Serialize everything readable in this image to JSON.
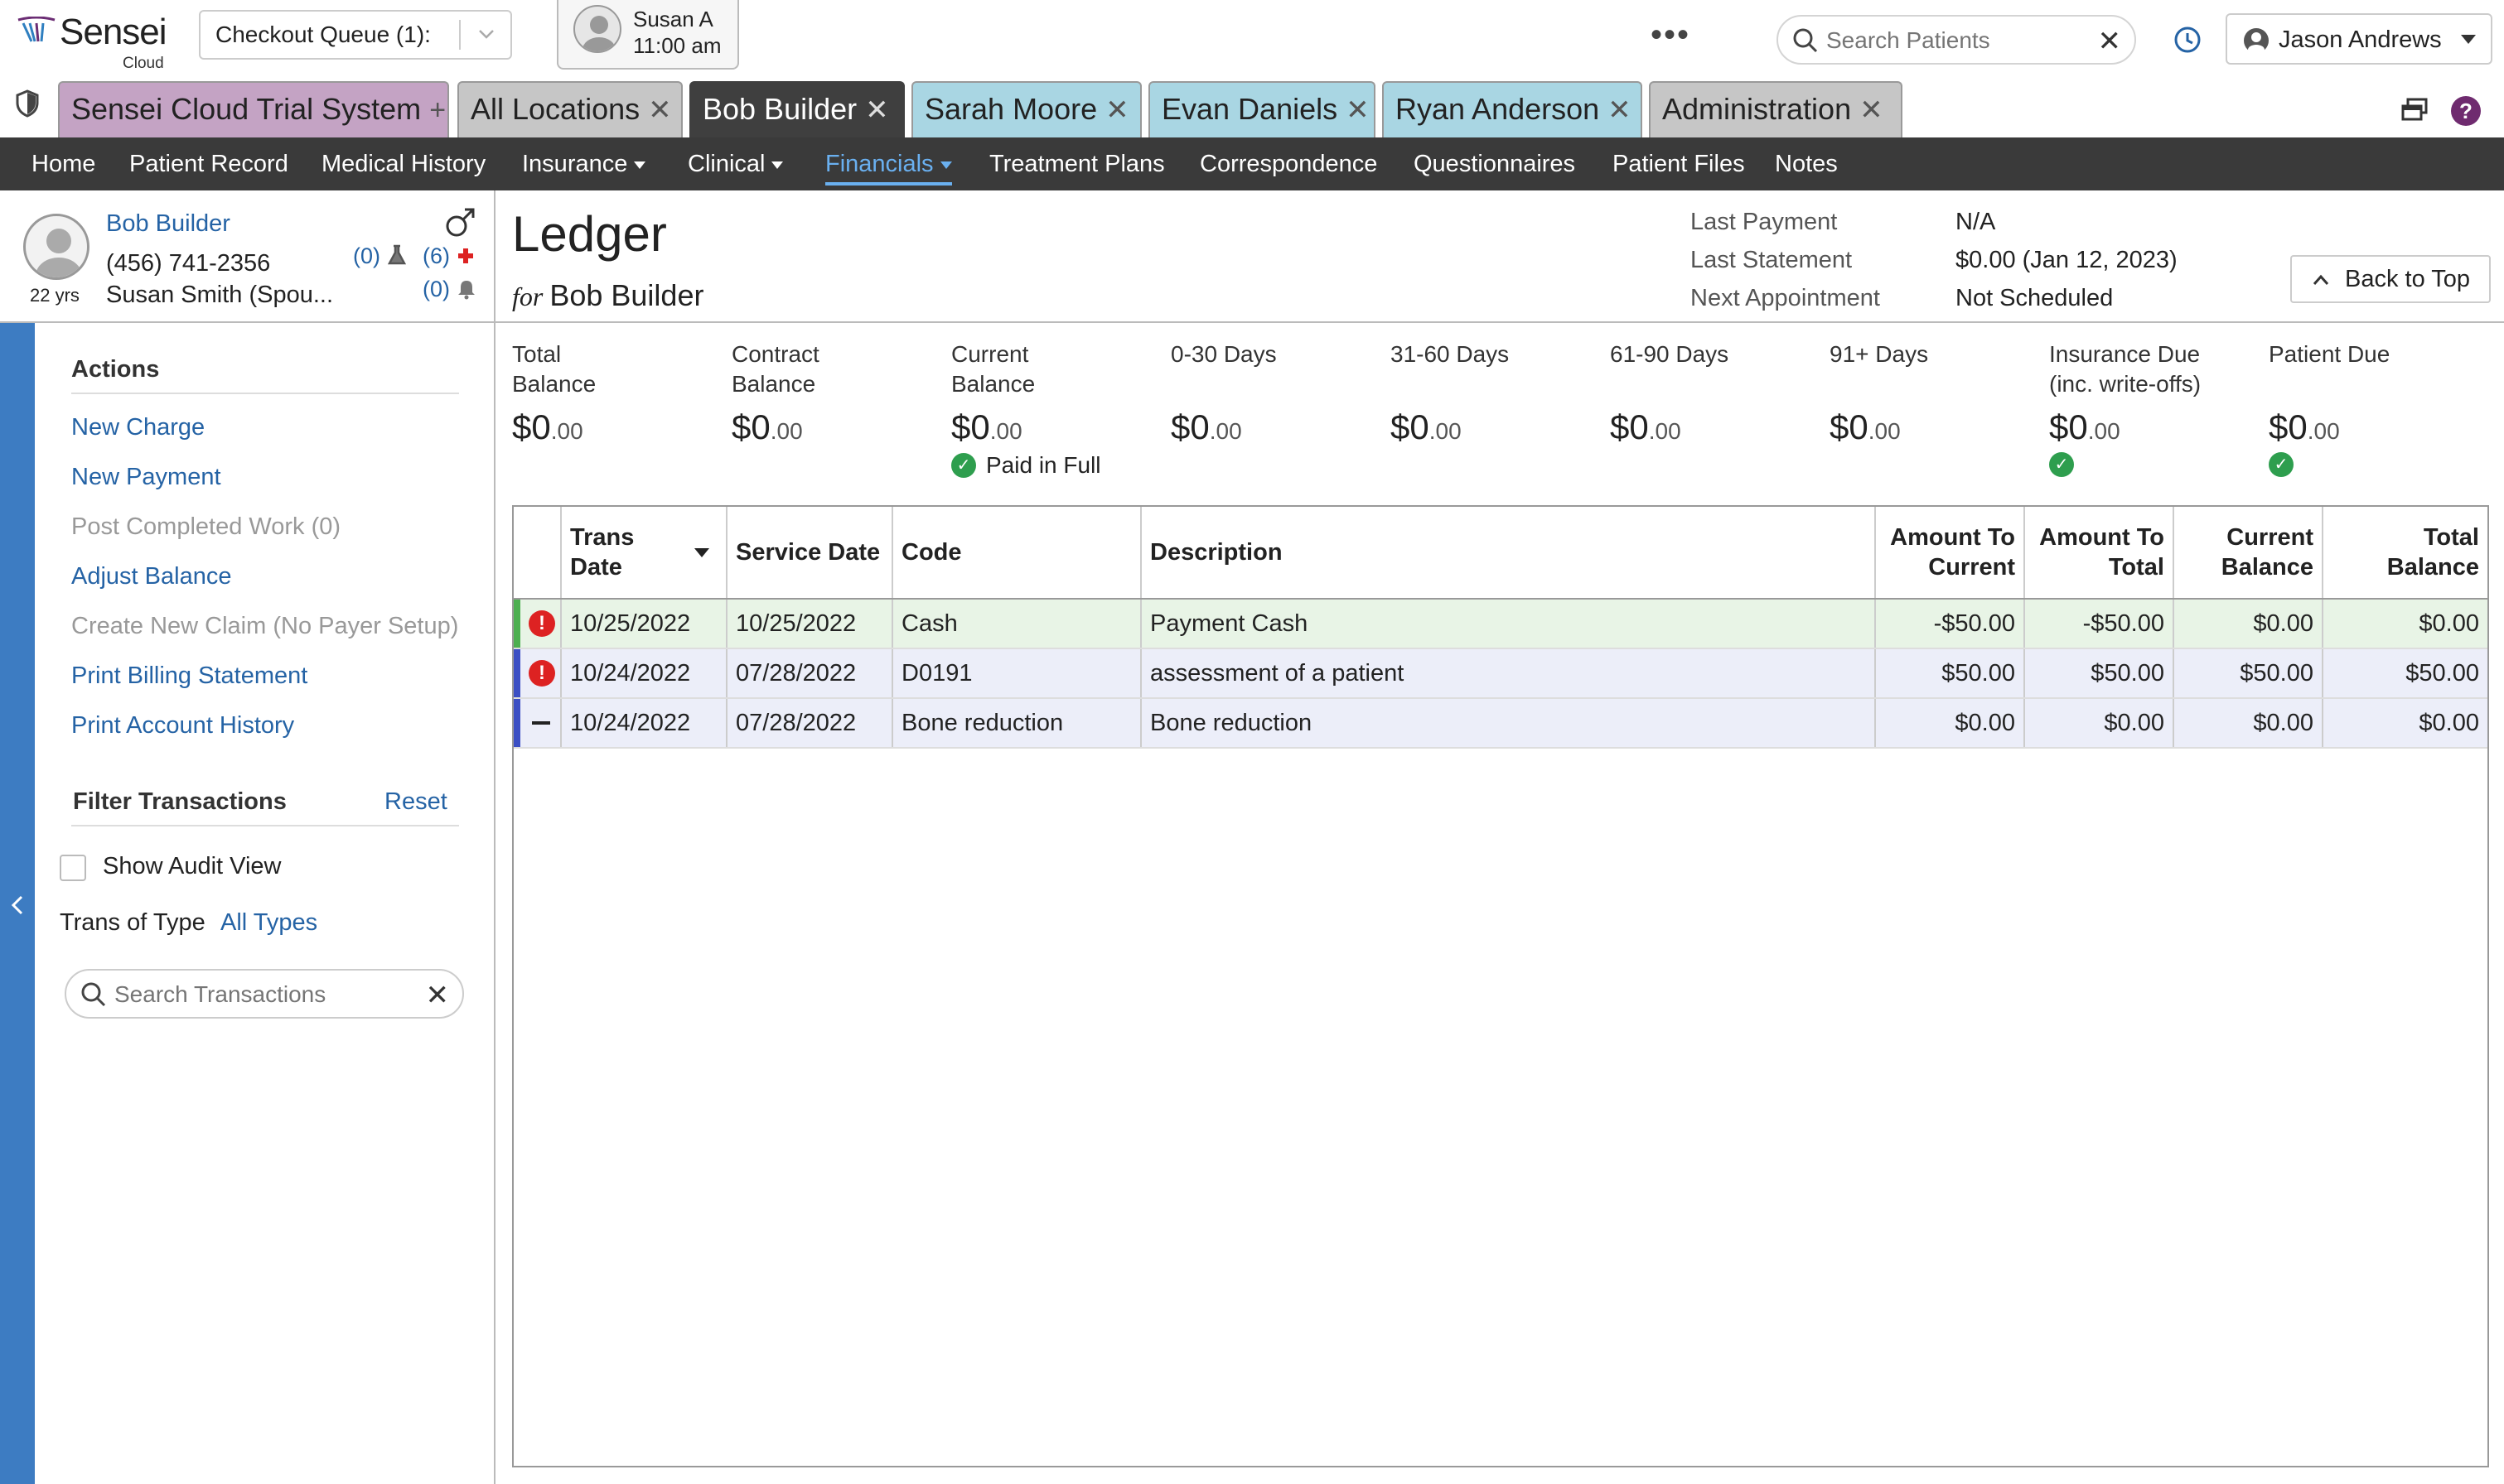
{
  "app": {
    "brand": "Sensei",
    "brand_sub": "Cloud"
  },
  "topbar": {
    "queue_label": "Checkout Queue (1):",
    "appointment": {
      "name": "Susan A",
      "time": "11:00 am"
    },
    "more": "•••",
    "search_placeholder": "Search Patients",
    "user_name": "Jason Andrews"
  },
  "tabs": [
    {
      "label": "Sensei Cloud Trial System",
      "action": "+"
    },
    {
      "label": "All Locations",
      "action": "✕"
    },
    {
      "label": "Bob Builder",
      "action": "✕"
    },
    {
      "label": "Sarah Moore",
      "action": "✕"
    },
    {
      "label": "Evan Daniels",
      "action": "✕"
    },
    {
      "label": "Ryan Anderson",
      "action": "✕"
    },
    {
      "label": "Administration",
      "action": "✕"
    }
  ],
  "nav": [
    "Home",
    "Patient Record",
    "Medical History",
    "Insurance",
    "Clinical",
    "Financials",
    "Treatment Plans",
    "Correspondence",
    "Questionnaires",
    "Patient Files",
    "Notes"
  ],
  "patient": {
    "name": "Bob Builder",
    "phone": "(456) 741-2356",
    "spouse": "Susan Smith (Spou...",
    "age": "22 yrs",
    "lab_count": "(0)",
    "medical_count": "(6)",
    "alert_count": "(0)"
  },
  "ledger": {
    "title": "Ledger",
    "for_label": "for",
    "for_name": "Bob Builder",
    "info": [
      {
        "label": "Last Payment",
        "value": "N/A"
      },
      {
        "label": "Last Statement",
        "value": "$0.00 (Jan 12, 2023)"
      },
      {
        "label": "Next Appointment",
        "value": "Not Scheduled"
      }
    ],
    "back_to_top": "Back to Top"
  },
  "sidebar": {
    "actions_heading": "Actions",
    "actions": [
      {
        "label": "New Charge",
        "enabled": true
      },
      {
        "label": "New Payment",
        "enabled": true
      },
      {
        "label": "Post Completed Work (0)",
        "enabled": false
      },
      {
        "label": "Adjust Balance",
        "enabled": true
      },
      {
        "label": "Create New Claim (No Payer Setup)",
        "enabled": false
      },
      {
        "label": "Print Billing Statement",
        "enabled": true
      },
      {
        "label": "Print Account History",
        "enabled": true
      }
    ],
    "filter_heading": "Filter Transactions",
    "reset": "Reset",
    "audit_label": "Show Audit View",
    "trans_type_label": "Trans of Type",
    "trans_type_value": "All Types",
    "search_placeholder": "Search Transactions"
  },
  "summary": [
    {
      "l1": "Total",
      "l2": "Balance",
      "dollars": "$0",
      "cents": ".00"
    },
    {
      "l1": "Contract",
      "l2": "Balance",
      "dollars": "$0",
      "cents": ".00"
    },
    {
      "l1": "Current",
      "l2": "Balance",
      "dollars": "$0",
      "cents": ".00",
      "status": "Paid in Full"
    },
    {
      "l1": "0-30 Days",
      "l2": "",
      "dollars": "$0",
      "cents": ".00"
    },
    {
      "l1": "31-60 Days",
      "l2": "",
      "dollars": "$0",
      "cents": ".00"
    },
    {
      "l1": "61-90 Days",
      "l2": "",
      "dollars": "$0",
      "cents": ".00"
    },
    {
      "l1": "91+ Days",
      "l2": "",
      "dollars": "$0",
      "cents": ".00"
    },
    {
      "l1": "Insurance Due",
      "l2": "(inc. write-offs)",
      "dollars": "$0",
      "cents": ".00",
      "status": ""
    },
    {
      "l1": "Patient Due",
      "l2": "",
      "dollars": "$0",
      "cents": ".00",
      "status": ""
    }
  ],
  "table": {
    "headers": [
      "Trans Date",
      "Service Date",
      "Code",
      "Description",
      "Amount To Current",
      "Amount To Total",
      "Current Balance",
      "Total Balance"
    ],
    "header_lines": [
      [
        "Trans",
        "Date"
      ],
      [
        "Service Date"
      ],
      [
        "Code"
      ],
      [
        "Description"
      ],
      [
        "Amount To",
        "Current"
      ],
      [
        "Amount To",
        "Total"
      ],
      [
        "Current",
        "Balance"
      ],
      [
        "Total",
        "Balance"
      ]
    ],
    "rows": [
      {
        "status": "error",
        "stripe": "#4caf50",
        "bg": "#e8f4e6",
        "cells": [
          "10/25/2022",
          "10/25/2022",
          "Cash",
          "Payment Cash",
          "-$50.00",
          "-$50.00",
          "$0.00",
          "$0.00"
        ]
      },
      {
        "status": "error",
        "stripe": "#3b4fc4",
        "bg": "#eceef9",
        "cells": [
          "10/24/2022",
          "07/28/2022",
          "D0191",
          "assessment of a patient",
          "$50.00",
          "$50.00",
          "$50.00",
          "$50.00"
        ]
      },
      {
        "status": "neutral",
        "stripe": "#3b4fc4",
        "bg": "#eceef9",
        "cells": [
          "10/24/2022",
          "07/28/2022",
          "Bone reduction",
          "Bone reduction",
          "$0.00",
          "$0.00",
          "$0.00",
          "$0.00"
        ]
      }
    ]
  }
}
